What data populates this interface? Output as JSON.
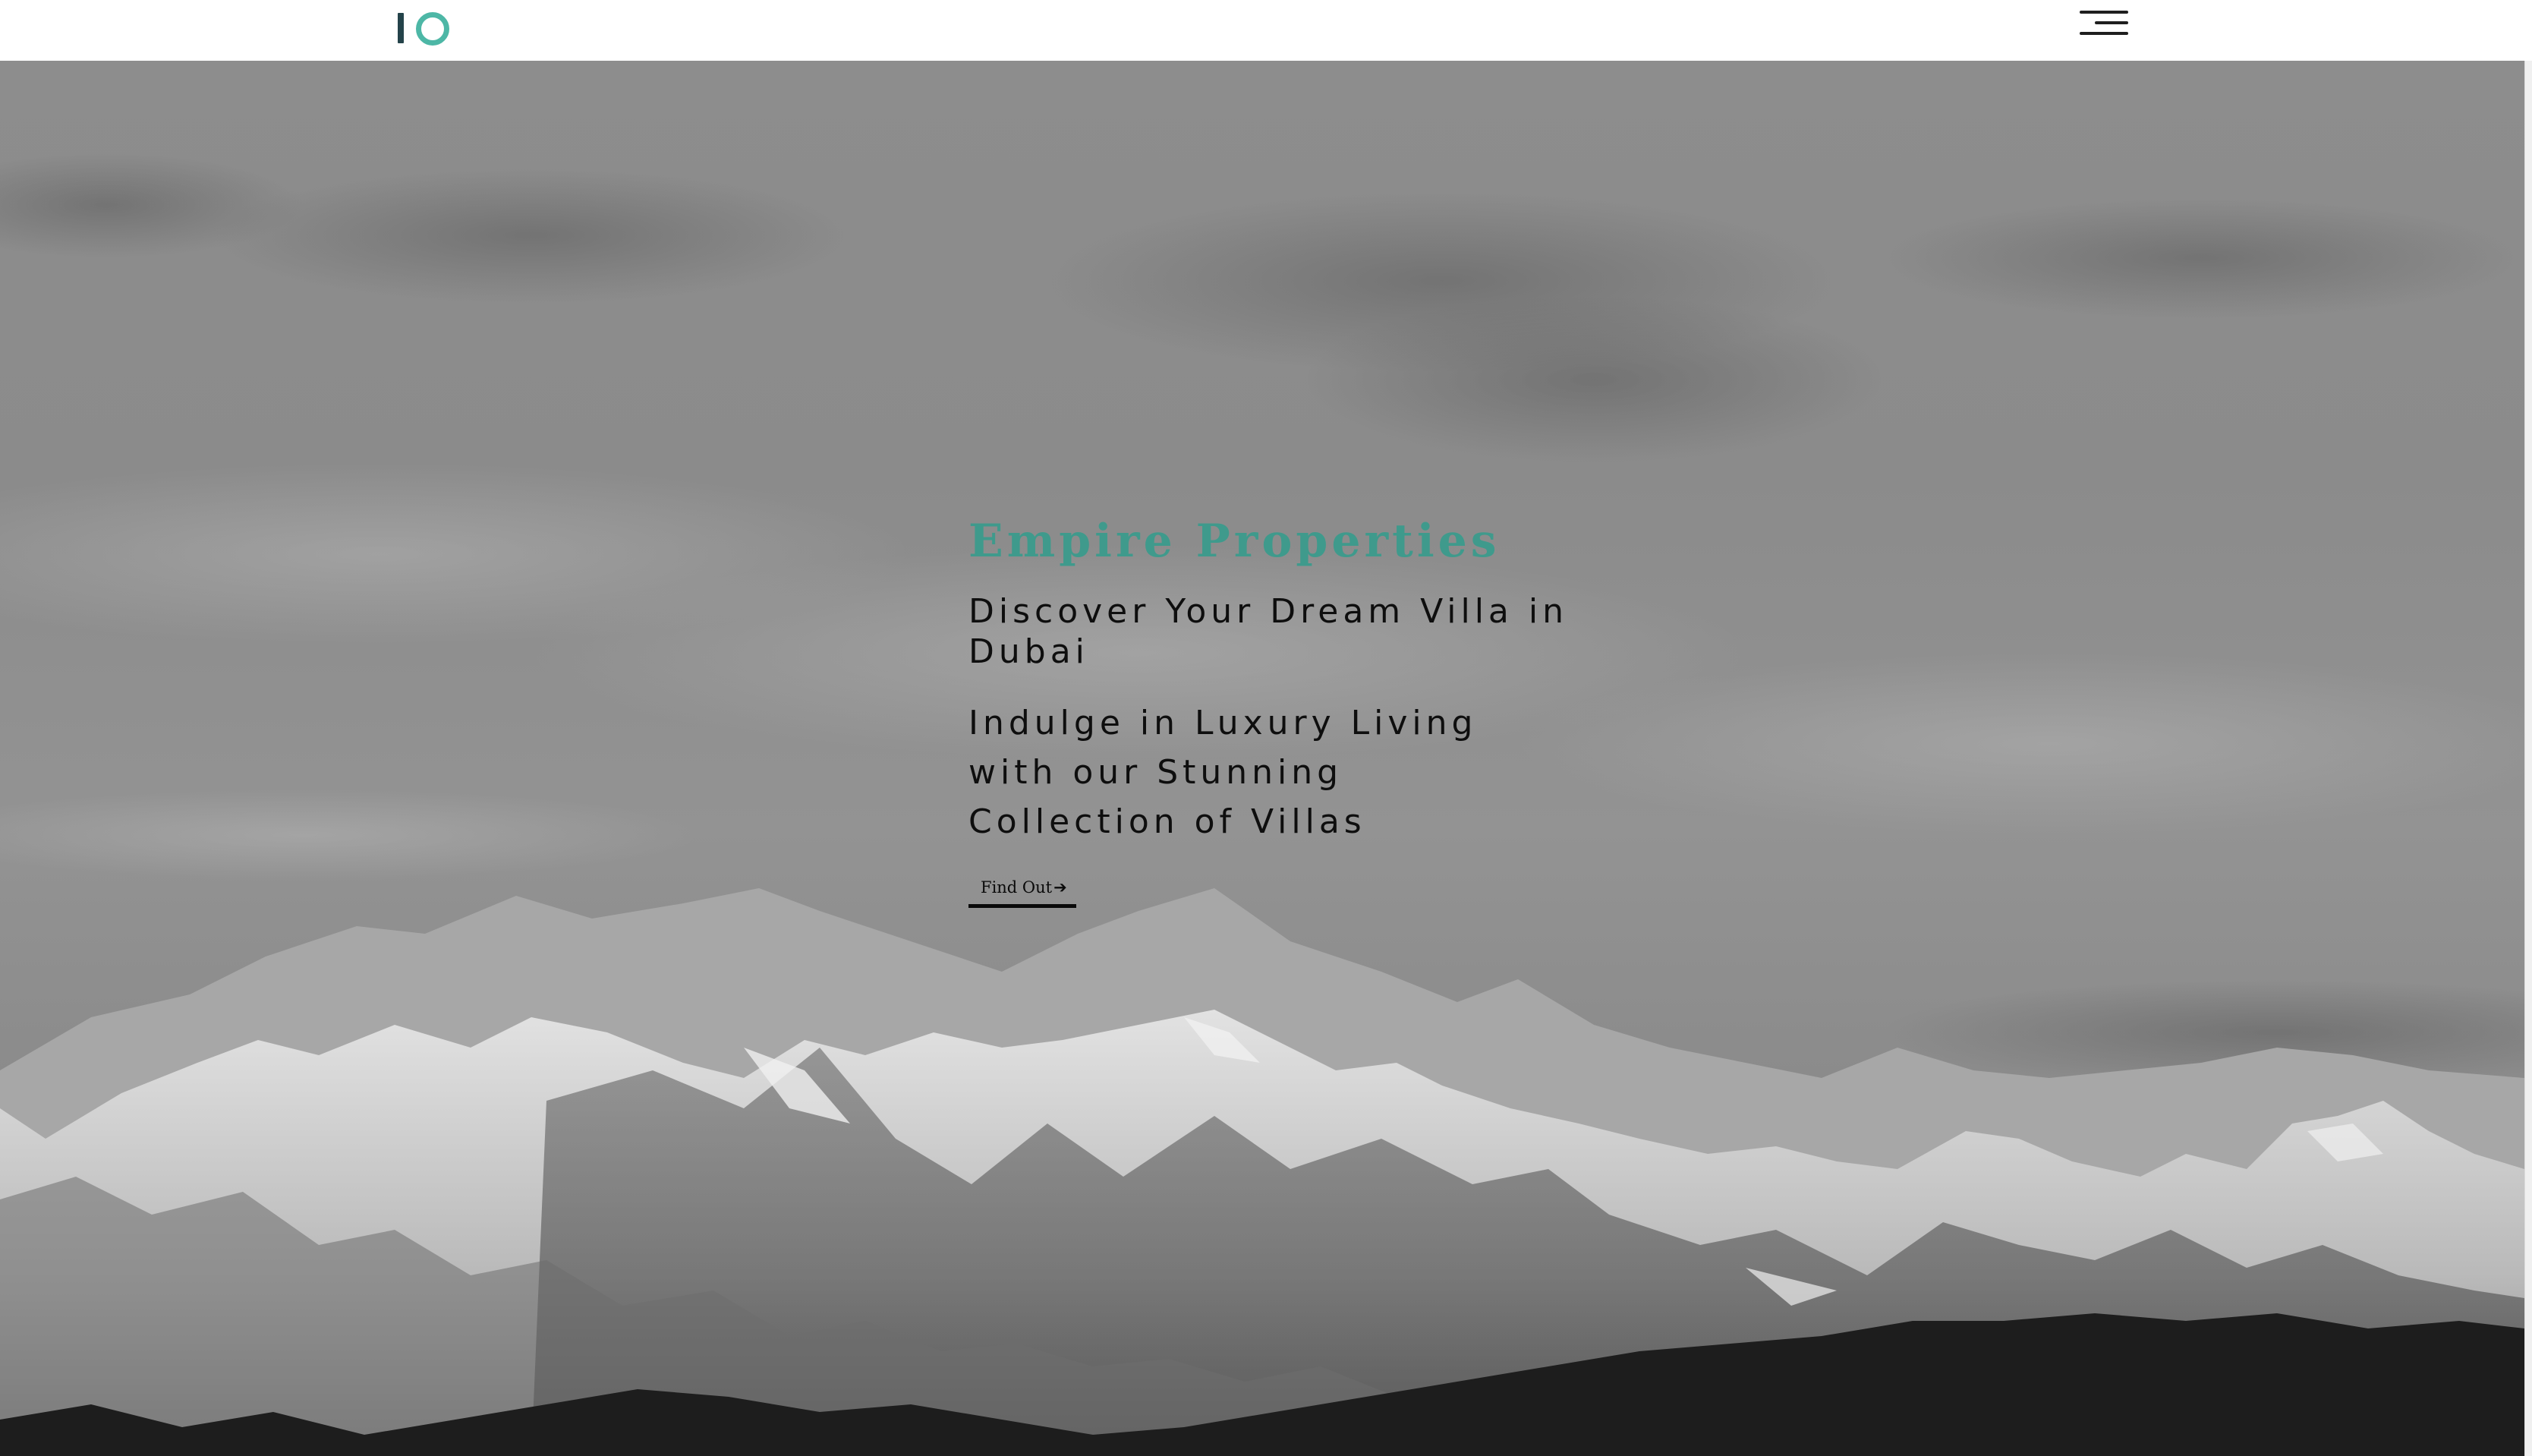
{
  "header": {
    "logo_icon": "io-logo-icon",
    "menu_icon": "hamburger-menu-icon"
  },
  "hero": {
    "brand_title": "Empire Properties",
    "headline": "Discover Your Dream Villa in Dubai",
    "subline": "Indulge in Luxury Living with our Stunning Collection of Villas",
    "cta_label": "Find Out",
    "cta_arrow": "➔",
    "background_image": "snowy-mountain-range-grayscale"
  },
  "colors": {
    "accent": "#3f9a8c",
    "logo_teal": "#4db7a6",
    "logo_dark": "#24434a",
    "text_dark": "#0e0e0e"
  }
}
